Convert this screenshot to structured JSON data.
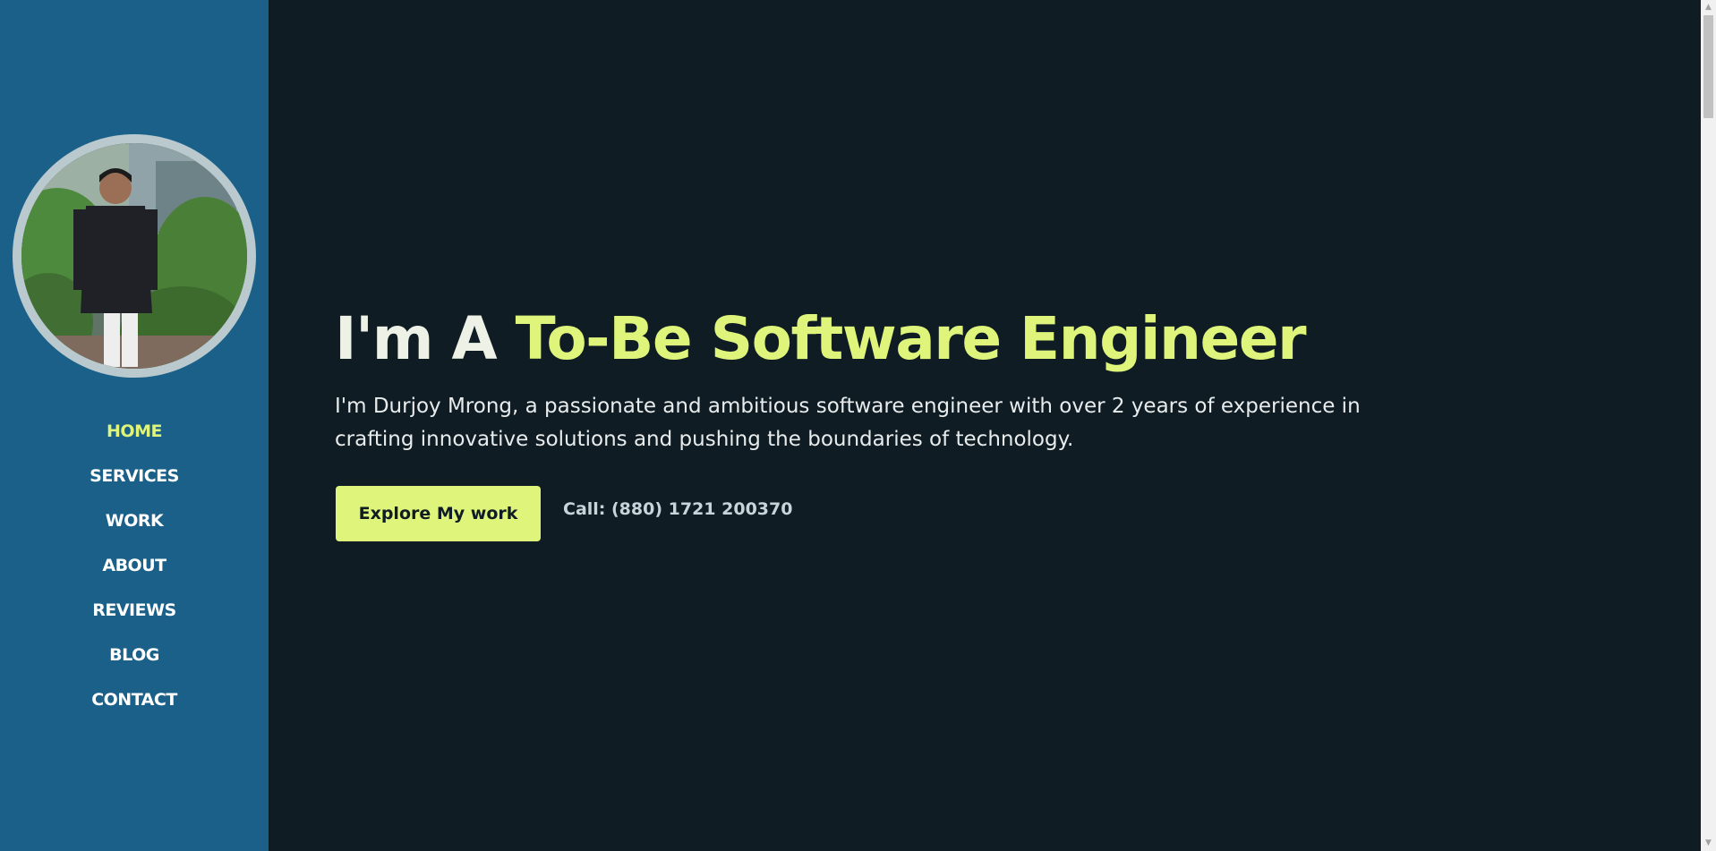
{
  "sidebar": {
    "profile_photo": "portrait-photo",
    "nav_items": [
      {
        "label": "HOME",
        "active": true
      },
      {
        "label": "SERVICES",
        "active": false
      },
      {
        "label": "WORK",
        "active": false
      },
      {
        "label": "ABOUT",
        "active": false
      },
      {
        "label": "REVIEWS",
        "active": false
      },
      {
        "label": "BLOG",
        "active": false
      },
      {
        "label": "CONTACT",
        "active": false
      }
    ]
  },
  "hero": {
    "heading_prefix": "I'm A ",
    "heading_highlight": "To-Be Software Engineer",
    "description": "I'm Durjoy Mrong, a passionate and ambitious software engineer with over 2 years of experience in crafting innovative solutions and pushing the boundaries of technology.",
    "cta_label": "Explore My work",
    "call_text": "Call: (880) 1721 200370"
  },
  "scrollbar": {
    "up_icon": "scroll-up-arrow-icon",
    "down_icon": "scroll-down-arrow-icon"
  },
  "colors": {
    "sidebar_bg": "#1a6089",
    "main_bg": "#0f1c24",
    "accent": "#dff47a",
    "heading_text": "#eef2e6",
    "nav_text": "#ffffff"
  }
}
